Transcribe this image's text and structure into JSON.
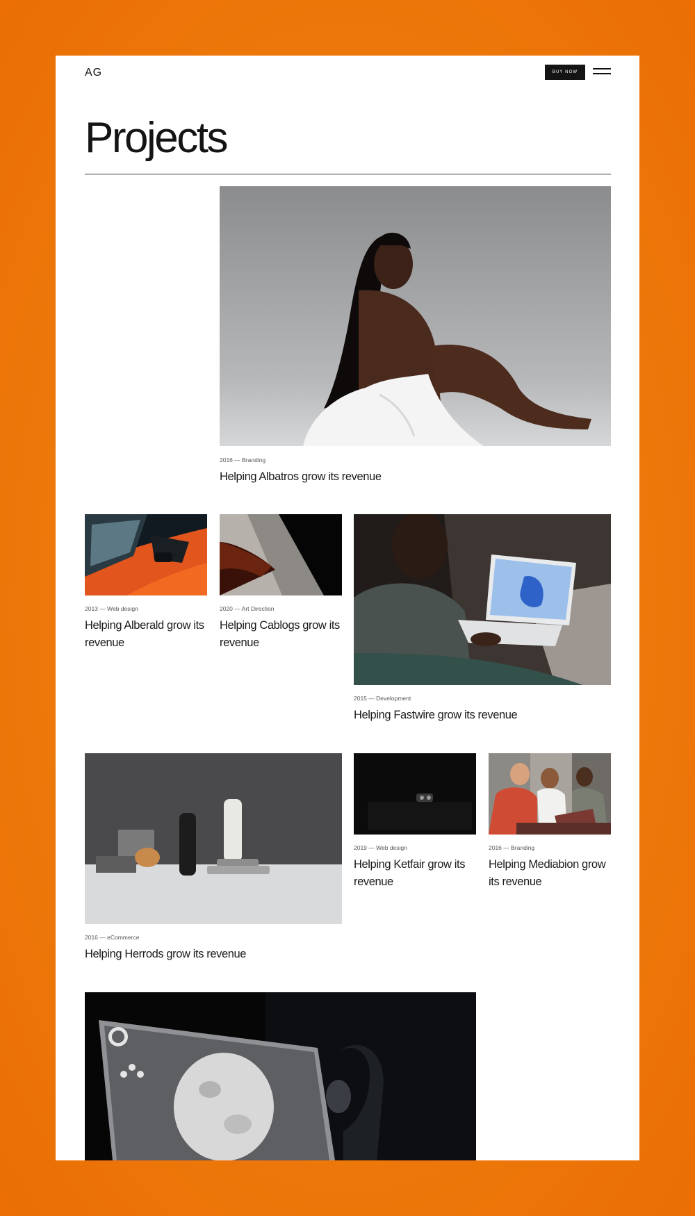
{
  "header": {
    "logo": "AG",
    "buy_label": "BUY NOW"
  },
  "page": {
    "title": "Projects"
  },
  "projects": [
    {
      "meta": "2016 — Branding",
      "title": "Helping Albatros grow its revenue"
    },
    {
      "meta": "2013 — Web design",
      "title": "Helping Alberald grow its revenue"
    },
    {
      "meta": "2020 — Art Direction",
      "title": "Helping Cablogs grow its revenue"
    },
    {
      "meta": "2015 — Development",
      "title": "Helping Fastwire grow its revenue"
    },
    {
      "meta": "2016 — eCommerce",
      "title": "Helping Herrods grow its revenue"
    },
    {
      "meta": "2019 — Web design",
      "title": "Helping Ketfair grow its revenue"
    },
    {
      "meta": "2016 — Branding",
      "title": "Helping Mediabion grow its revenue"
    }
  ],
  "icons": {
    "menu": "hamburger-menu-icon"
  },
  "colors": {
    "background": "#ee7a0c",
    "surface": "#ffffff",
    "text": "#141414"
  }
}
